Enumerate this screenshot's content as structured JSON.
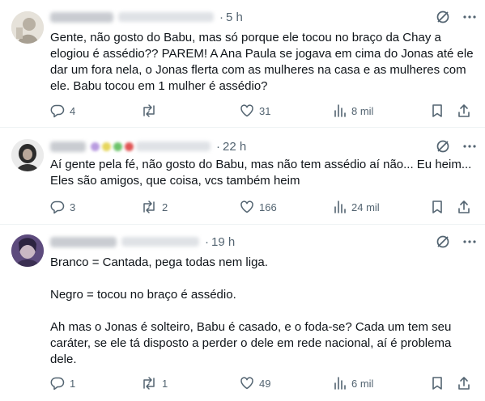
{
  "tweets": [
    {
      "time": "5 h",
      "text": "Gente, não gosto do Babu, mas só porque ele tocou no braço da Chay a elogiou é assédio?? PAREM! A Ana Paula se jogava em cima do Jonas até ele dar um fora nela, o Jonas flerta com as mulheres na casa e as mulheres com ele. Babu tocou em 1 mulher é assédio?",
      "replies": "4",
      "reposts": "",
      "likes": "31",
      "views": "8 mil"
    },
    {
      "time": "22 h",
      "text": "Aí gente pela fé, não gosto do Babu, mas não tem assédio aí não... Eu heim... Eles são amigos, que coisa, vcs também heim",
      "replies": "3",
      "reposts": "2",
      "likes": "166",
      "views": "24 mil"
    },
    {
      "time": "19 h",
      "text": "Branco = Cantada, pega todas nem liga.\n\nNegro = tocou no braço é assédio.\n\nAh mas o Jonas é solteiro, Babu é casado, e o foda-se? Cada um tem seu caráter, se ele tá disposto a perder o dele em rede nacional, aí é problema dele.",
      "replies": "1",
      "reposts": "1",
      "likes": "49",
      "views": "6 mil"
    }
  ],
  "colors": {
    "text": "#0f1419",
    "muted": "#536471",
    "divider": "#eff3f4"
  },
  "icons": [
    "grok-icon",
    "more-icon",
    "reply-icon",
    "repost-icon",
    "like-icon",
    "views-icon",
    "bookmark-icon",
    "share-icon"
  ]
}
